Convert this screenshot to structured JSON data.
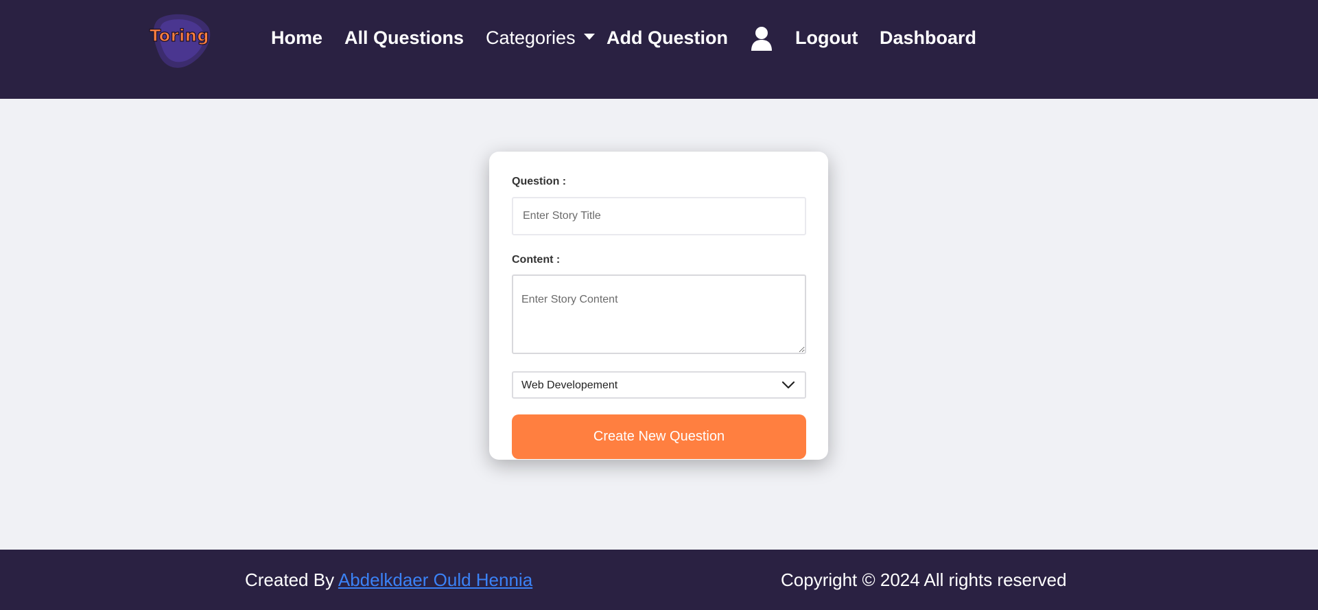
{
  "brand": {
    "logo_text": "Toring"
  },
  "nav": {
    "home": "Home",
    "all_questions": "All Questions",
    "categories": "Categories",
    "add_question": "Add Question",
    "logout": "Logout",
    "dashboard": "Dashboard",
    "user_icon": "user-icon",
    "caret_icon": "caret-down-icon"
  },
  "form": {
    "question_label": "Question :",
    "question_placeholder": "Enter Story Title",
    "content_label": "Content :",
    "content_placeholder": "Enter Story Content",
    "category_selected": "Web Developement",
    "submit_label": "Create New Question"
  },
  "footer": {
    "created_by": "Created By",
    "author": "Abdelkdaer Ould Hennia",
    "copyright": "Copyright © 2024 All rights reserved"
  },
  "colors": {
    "navbar_bg": "#2a2142",
    "page_bg": "#f0f1f5",
    "accent": "#ff7f40",
    "link": "#3b82f6"
  }
}
